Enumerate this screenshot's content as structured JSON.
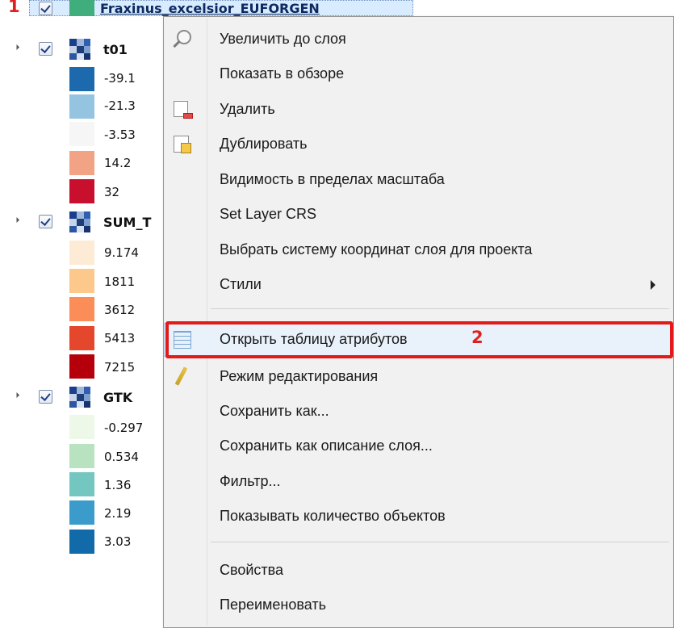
{
  "badges": {
    "one": "1",
    "two": "2"
  },
  "layers": [
    {
      "name": "Fraxinus_excelsior_EUFORGEN",
      "selected": true,
      "expanded": false
    },
    {
      "name": "t01",
      "legend": [
        {
          "label": "-39.1",
          "color": "#1c6aad"
        },
        {
          "label": "-21.3",
          "color": "#94c4e0"
        },
        {
          "label": "-3.53",
          "color": "#f6f6f6"
        },
        {
          "label": "14.2",
          "color": "#f2a386"
        },
        {
          "label": "32",
          "color": "#c8102e"
        }
      ]
    },
    {
      "name": "SUM_T",
      "legend": [
        {
          "label": "9.174",
          "color": "#fdebd6"
        },
        {
          "label": "1811",
          "color": "#fcc88b"
        },
        {
          "label": "3612",
          "color": "#fb8d59"
        },
        {
          "label": "5413",
          "color": "#e5472c"
        },
        {
          "label": "7215",
          "color": "#b5000c"
        }
      ]
    },
    {
      "name": "GTK",
      "legend": [
        {
          "label": "-0.297",
          "color": "#edf8e9"
        },
        {
          "label": "0.534",
          "color": "#b8e2c0"
        },
        {
          "label": "1.36",
          "color": "#74c6c1"
        },
        {
          "label": "2.19",
          "color": "#3b9ccb"
        },
        {
          "label": "3.03",
          "color": "#136aa9"
        }
      ]
    }
  ],
  "menu": {
    "items": [
      {
        "label": "Увеличить до слоя",
        "icon": "zoom-icon"
      },
      {
        "label": "Показать в обзоре",
        "icon": ""
      },
      {
        "label": "Удалить",
        "icon": "remove-layer-icon"
      },
      {
        "label": "Дублировать",
        "icon": "duplicate-layer-icon"
      },
      {
        "label": "Видимость в пределах масштаба",
        "icon": ""
      },
      {
        "label": "Set Layer CRS",
        "icon": ""
      },
      {
        "label": "Выбрать систему координат слоя для проекта",
        "icon": ""
      },
      {
        "label": "Стили",
        "icon": "",
        "submenu": true
      },
      {
        "label": "Открыть таблицу атрибутов",
        "icon": "attribute-table-icon",
        "highlighted": true
      },
      {
        "label": "Режим редактирования",
        "icon": "pencil-icon"
      },
      {
        "label": "Сохранить как...",
        "icon": ""
      },
      {
        "label": "Сохранить как описание слоя...",
        "icon": ""
      },
      {
        "label": "Фильтр...",
        "icon": ""
      },
      {
        "label": "Показывать количество объектов",
        "icon": ""
      },
      {
        "label": "Свойства",
        "icon": ""
      },
      {
        "label": "Переименовать",
        "icon": ""
      }
    ]
  }
}
